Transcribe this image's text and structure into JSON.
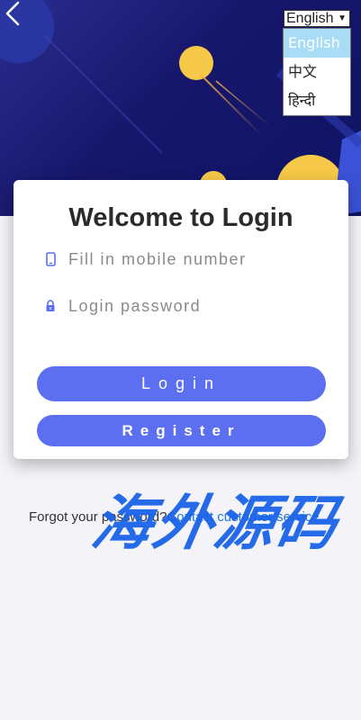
{
  "header": {
    "back_icon": "chevron-left-icon",
    "language": {
      "selected": "English",
      "options": [
        "English",
        "中文",
        "हिन्दी"
      ]
    }
  },
  "login_card": {
    "title": "Welcome to Login",
    "mobile_placeholder": "Fill in mobile number",
    "mobile_icon": "phone-icon",
    "password_placeholder": "Login password",
    "password_icon": "lock-icon",
    "login_label": "Login",
    "register_label": "Register"
  },
  "footer": {
    "forgot_text": "Forgot your password?",
    "contact_text": "Contact customer service"
  },
  "watermark": "海外源码",
  "colors": {
    "accent": "#5b6ff0",
    "hero": "#16166b",
    "link": "#1d7ad6",
    "watermark": "#1a63e8"
  }
}
